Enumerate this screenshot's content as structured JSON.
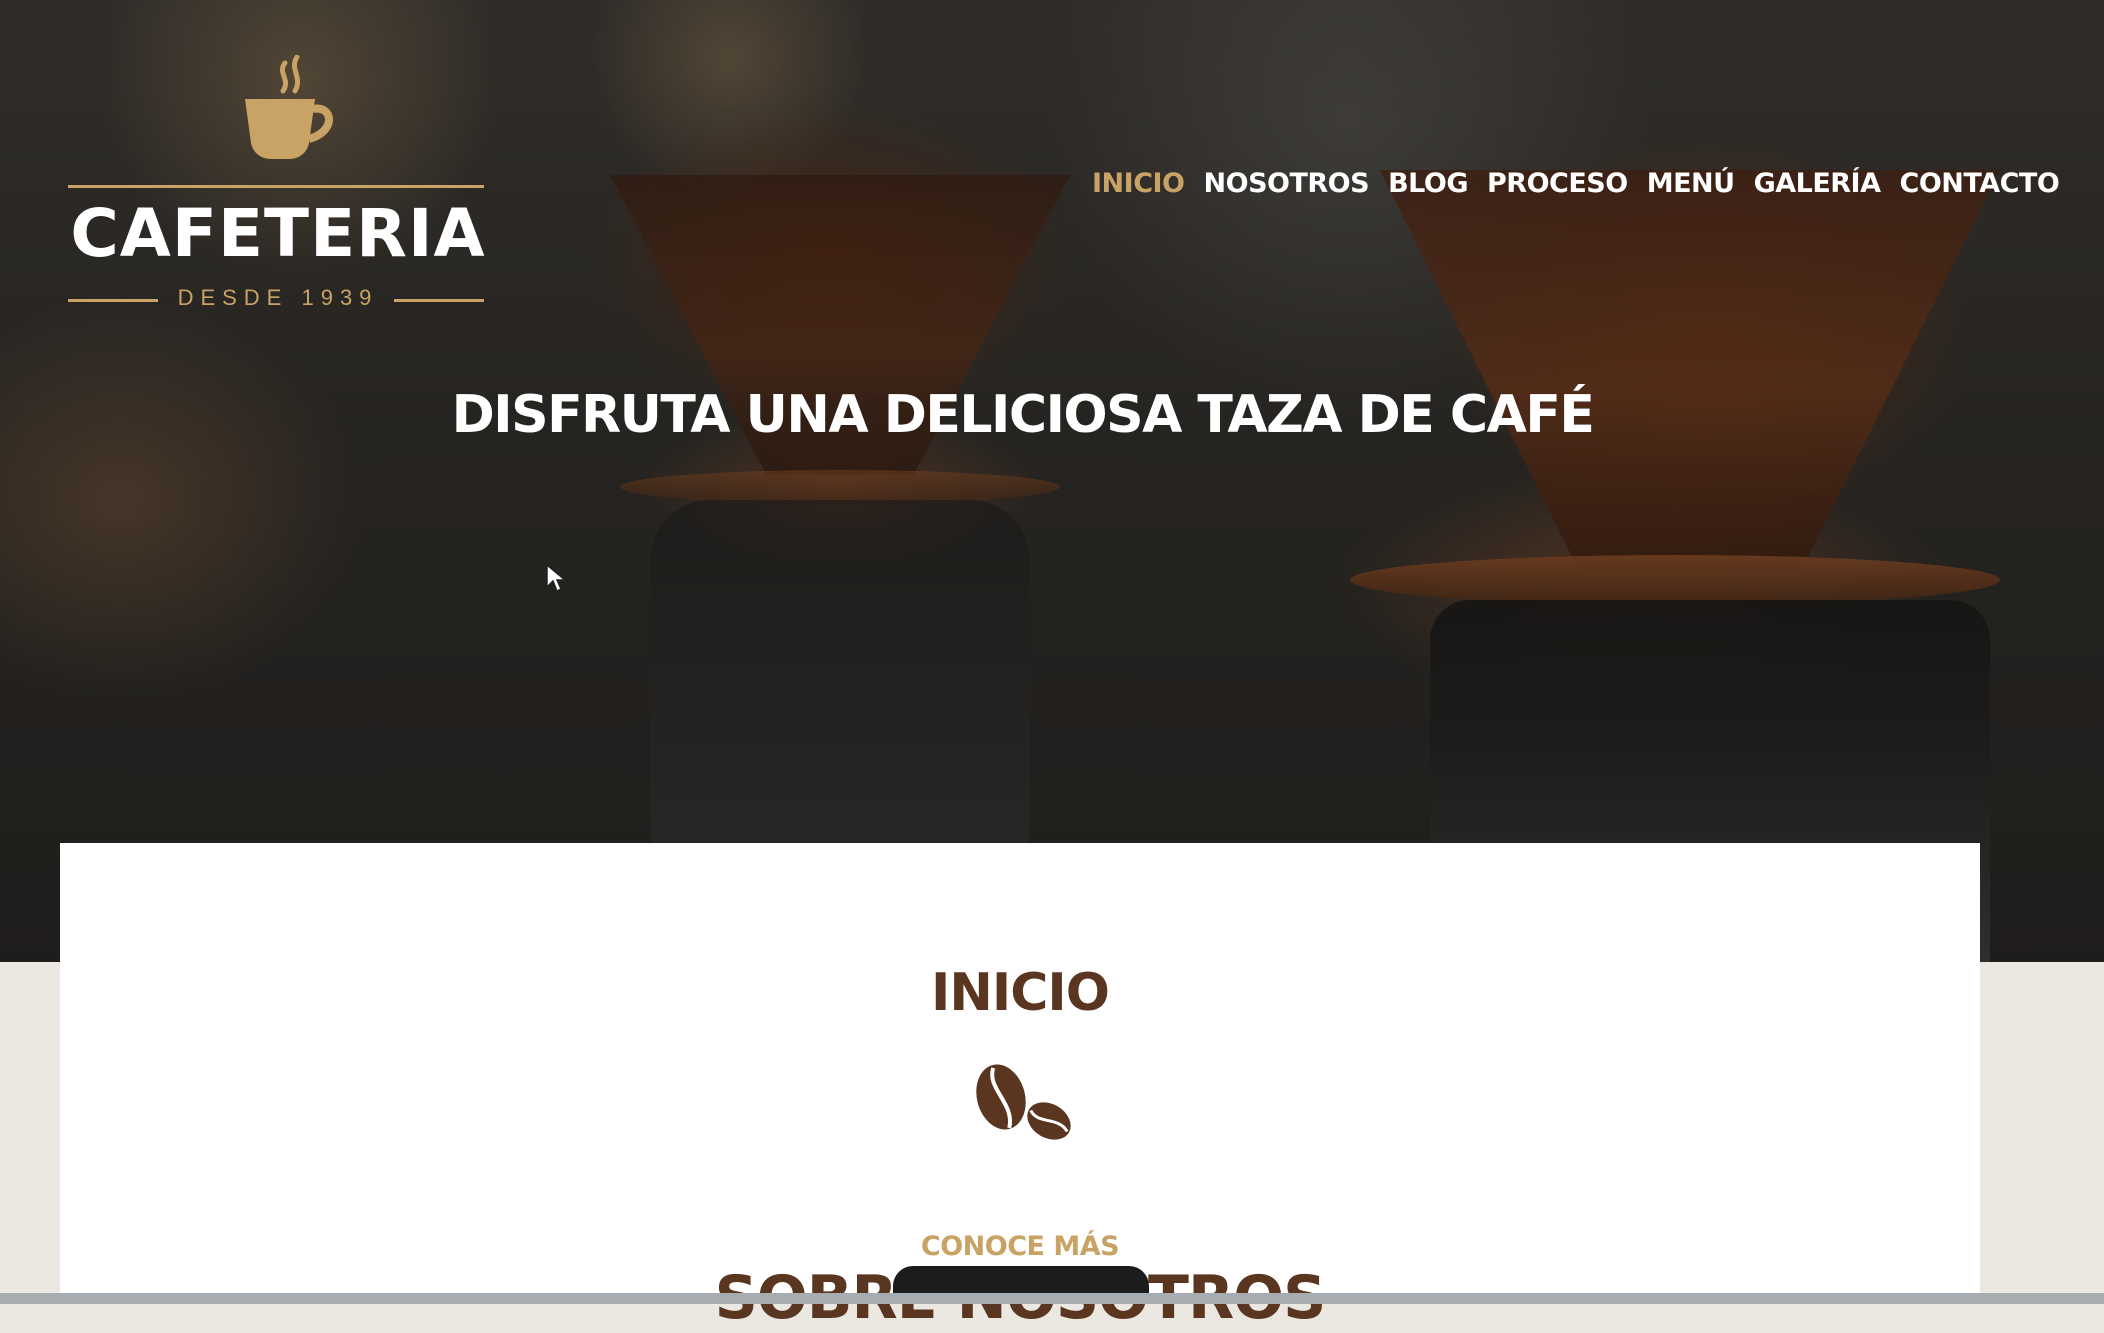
{
  "logo": {
    "name": "CAFETERIA",
    "since": "DESDE 1939"
  },
  "nav": {
    "items": [
      {
        "label": "INICIO",
        "active": true
      },
      {
        "label": "NOSOTROS",
        "active": false
      },
      {
        "label": "BLOG",
        "active": false
      },
      {
        "label": "PROCESO",
        "active": false
      },
      {
        "label": "MENÚ",
        "active": false
      },
      {
        "label": "GALERÍA",
        "active": false
      },
      {
        "label": "CONTACTO",
        "active": false
      }
    ]
  },
  "hero": {
    "title": "DISFRUTA UNA DELICIOSA TAZA DE CAFÉ"
  },
  "section": {
    "title": "INICIO",
    "kicker": "CONOCE MÁS",
    "heading": "SOBRE NOSOTROS"
  },
  "colors": {
    "accent": "#c9a365",
    "brown": "#5a3621",
    "white": "#ffffff",
    "page_bg": "#ebe8e1"
  },
  "icons": {
    "logo": "coffee-cup-icon",
    "section": "coffee-beans-icon",
    "cursor": "mouse-cursor-icon"
  }
}
